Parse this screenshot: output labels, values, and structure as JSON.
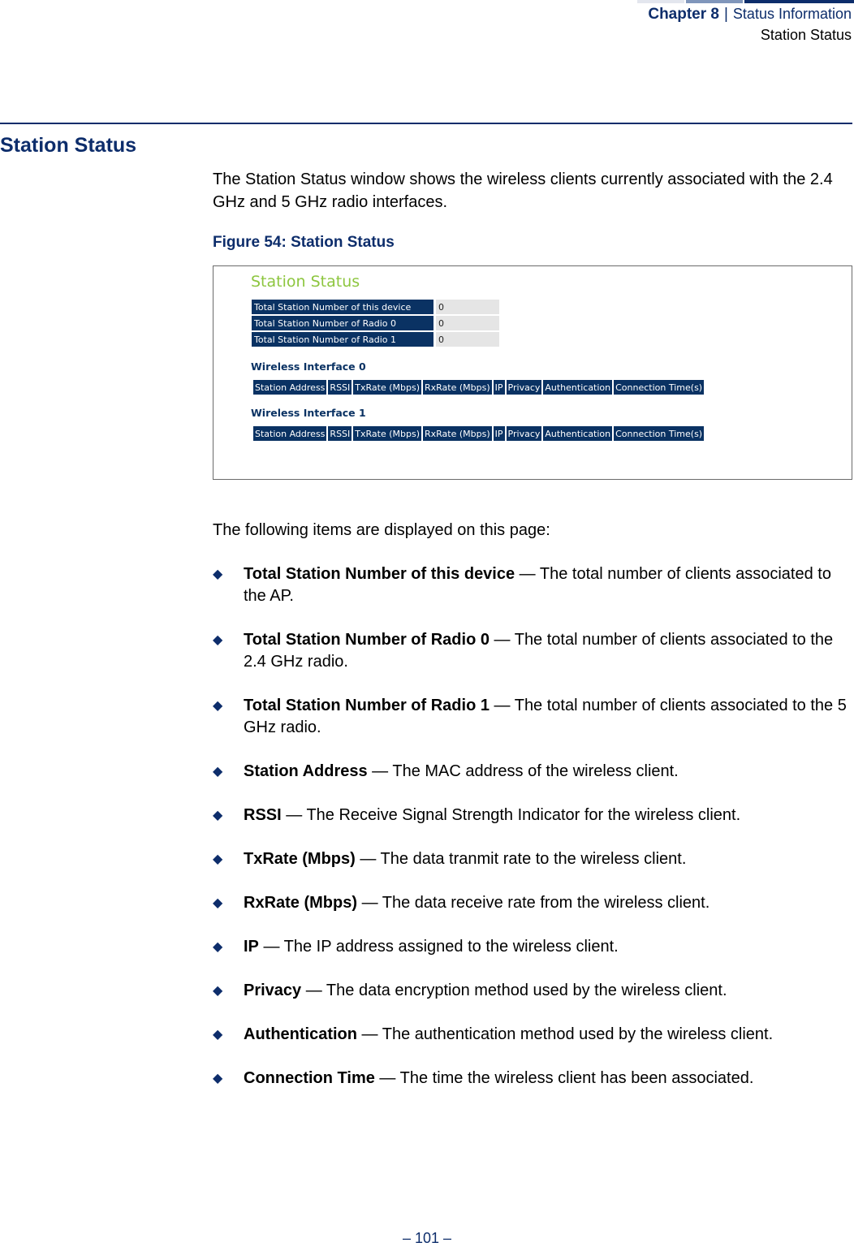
{
  "header": {
    "chapter": "Chapter 8",
    "separator": "|",
    "section": "Status Information",
    "subsection": "Station Status",
    "bar_colors": [
      "#e3e6ee",
      "#8096bb",
      "#0d2d6b"
    ]
  },
  "section_title": "Station Status",
  "intro": "The Station Status window shows the wireless clients currently associated with the 2.4 GHz and 5 GHz radio interfaces.",
  "figure": {
    "caption": "Figure 54:  Station Status",
    "ui": {
      "title": "Station Status",
      "summary": [
        {
          "label": "Total Station Number of this device",
          "value": "0"
        },
        {
          "label": "Total Station Number of Radio 0",
          "value": "0"
        },
        {
          "label": "Total Station Number of Radio 1",
          "value": "0"
        }
      ],
      "interfaces": [
        {
          "title": "Wireless Interface 0",
          "columns": [
            "Station Address",
            "RSSI",
            "TxRate (Mbps)",
            "RxRate (Mbps)",
            "IP",
            "Privacy",
            "Authentication",
            "Connection Time(s)"
          ]
        },
        {
          "title": "Wireless Interface 1",
          "columns": [
            "Station Address",
            "RSSI",
            "TxRate (Mbps)",
            "RxRate (Mbps)",
            "IP",
            "Privacy",
            "Authentication",
            "Connection Time(s)"
          ]
        }
      ]
    }
  },
  "items_intro": "The following items are displayed on this page:",
  "items": [
    {
      "term": "Total Station Number of this device",
      "desc": " — The total number of clients associated to the AP."
    },
    {
      "term": "Total Station Number of Radio 0",
      "desc": " — The total number of clients associated to the 2.4 GHz radio."
    },
    {
      "term": "Total Station Number of Radio 1",
      "desc": " — The total number of clients associated to the 5 GHz radio."
    },
    {
      "term": "Station Address",
      "desc": " — The MAC address of the wireless client."
    },
    {
      "term": "RSSI",
      "desc": " — The Receive Signal Strength Indicator for the wireless client."
    },
    {
      "term": "TxRate (Mbps)",
      "desc": " — The data tranmit rate to the wireless client."
    },
    {
      "term": "RxRate (Mbps)",
      "desc": " — The data receive rate from the wireless client."
    },
    {
      "term": "IP",
      "desc": " — The IP address assigned to the wireless client."
    },
    {
      "term": "Privacy",
      "desc": " — The data encryption method used by the wireless client."
    },
    {
      "term": "Authentication",
      "desc": " — The authentication method used by the wireless client."
    },
    {
      "term": "Connection Time",
      "desc": " — The time the wireless client has been associated."
    }
  ],
  "bullet_glyph": "◆",
  "page_number": "–  101  –"
}
